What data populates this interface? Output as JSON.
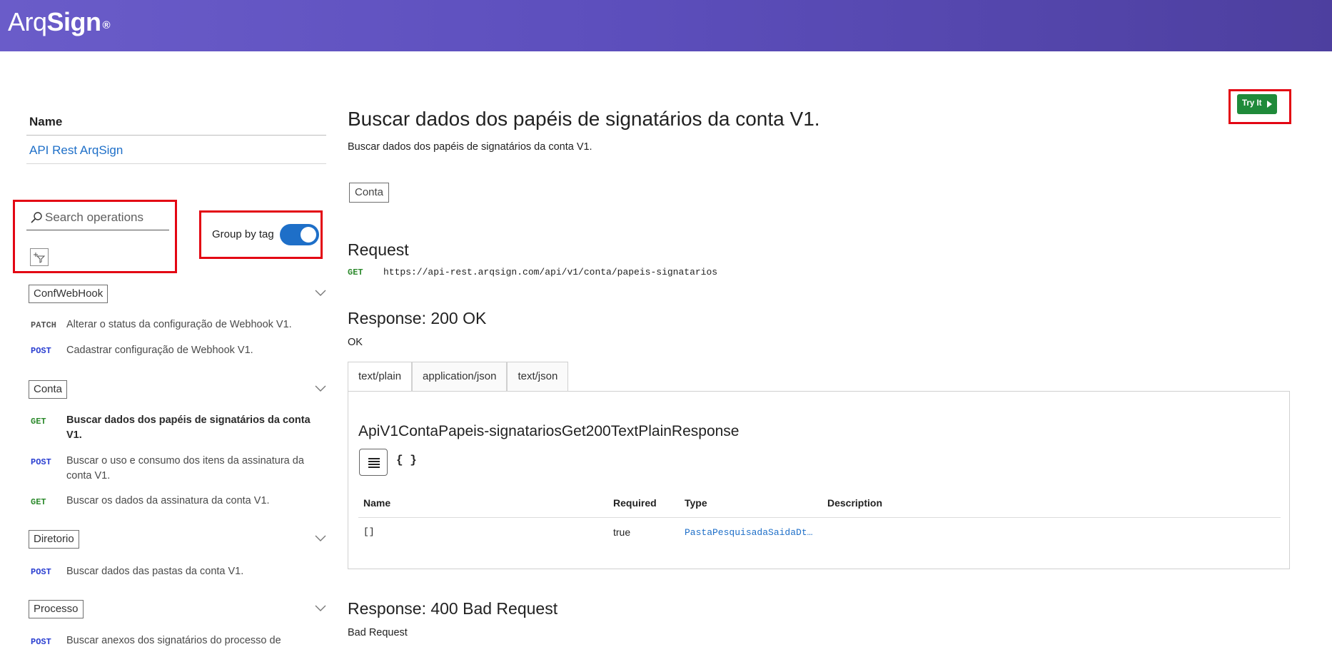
{
  "header": {
    "brand_light": "Arq",
    "brand_bold": "Sign",
    "brand_reg": "®"
  },
  "sidebar": {
    "name_header": "Name",
    "api_link": "API Rest ArqSign",
    "search_placeholder": "Search operations",
    "group_by_label": "Group by tag",
    "group_by_enabled": true,
    "groups": [
      {
        "tag": "ConfWebHook",
        "ops": [
          {
            "method": "PATCH",
            "label": "Alterar o status da configuração de Webhook V1."
          },
          {
            "method": "POST",
            "label": "Cadastrar configuração de Webhook V1."
          }
        ]
      },
      {
        "tag": "Conta",
        "ops": [
          {
            "method": "GET",
            "label": "Buscar dados dos papéis de signatários da conta V1."
          },
          {
            "method": "POST",
            "label": "Buscar o uso e consumo dos itens da assinatura da conta V1."
          },
          {
            "method": "GET",
            "label": "Buscar os dados da assinatura da conta V1."
          }
        ]
      },
      {
        "tag": "Diretorio",
        "ops": [
          {
            "method": "POST",
            "label": "Buscar dados das pastas da conta V1."
          }
        ]
      },
      {
        "tag": "Processo",
        "ops": [
          {
            "method": "POST",
            "label": "Buscar anexos dos signatários do processo de"
          }
        ]
      }
    ]
  },
  "main": {
    "title": "Buscar dados dos papéis de signatários da conta V1.",
    "subtitle": "Buscar dados dos papéis de signatários da conta V1.",
    "tag": "Conta",
    "request_heading": "Request",
    "request_method": "GET",
    "request_url": "https://api-rest.arqsign.com/api/v1/conta/papeis-signatarios",
    "response_200_heading": "Response: 200 OK",
    "response_200_text": "OK",
    "tabs": [
      "text/plain",
      "application/json",
      "text/json"
    ],
    "active_tab": "text/plain",
    "schema_title": "ApiV1ContaPapeis-signatariosGet200TextPlainResponse",
    "braces": "{ }",
    "table": {
      "headers": [
        "Name",
        "Required",
        "Type",
        "Description"
      ],
      "rows": [
        {
          "name": "[]",
          "required": "true",
          "type": "PastaPesquisadaSaidaDt…",
          "description": ""
        }
      ]
    },
    "response_400_heading": "Response: 400 Bad Request",
    "response_400_text": "Bad Request",
    "try_label": "Try It"
  },
  "colors": {
    "header_start": "#6a5cc9",
    "header_end": "#4d3f9f",
    "link": "#1e6fc8",
    "get": "#2e8b2e",
    "post": "#2b3fd1",
    "try": "#1f8a3a",
    "highlight": "#e30613"
  }
}
